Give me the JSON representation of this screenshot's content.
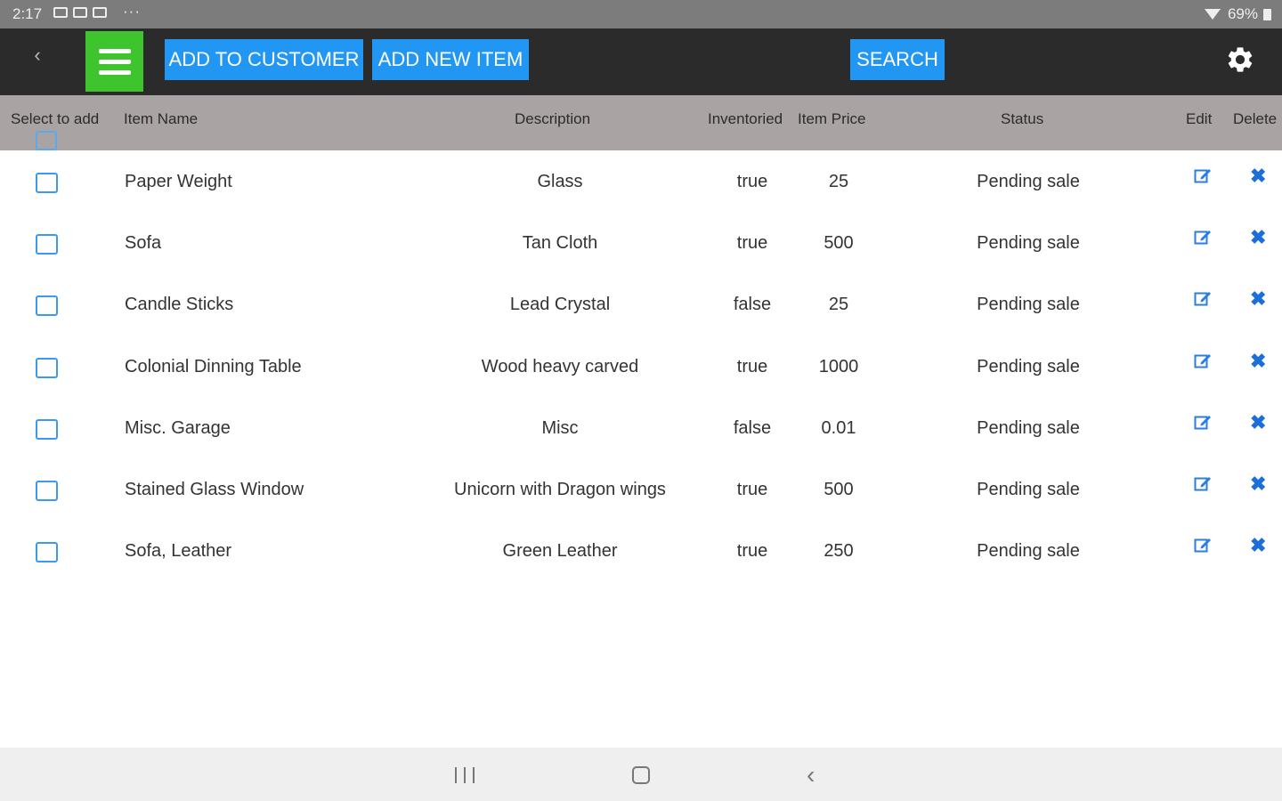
{
  "status_bar": {
    "time": "2:17",
    "more": "···",
    "battery": "69%"
  },
  "toolbar": {
    "back_glyph": "‹",
    "add_to_customer_label": "ADD TO CUSTOMER",
    "add_new_item_label": "ADD NEW ITEM",
    "search_label": "SEARCH",
    "menu_icon": "hamburger-menu-icon",
    "settings_icon": "gear-icon",
    "colors": {
      "background": "#2b2b2b",
      "menu": "#3ec42d",
      "button": "#2196f3"
    }
  },
  "table": {
    "headers": {
      "select": "Select to add",
      "name": "Item Name",
      "description": "Description",
      "inventoried": "Inventoried",
      "price": "Item Price",
      "status": "Status",
      "edit": "Edit",
      "delete": "Delete"
    },
    "header_color": "#a9a3a3",
    "rows": [
      {
        "name": "Paper Weight",
        "description": "Glass",
        "inventoried": "true",
        "price": "25",
        "status": "Pending sale",
        "delete_glyph": "✖"
      },
      {
        "name": "Sofa",
        "description": "Tan Cloth",
        "inventoried": "true",
        "price": "500",
        "status": "Pending sale",
        "delete_glyph": "✖"
      },
      {
        "name": "Candle Sticks",
        "description": "Lead Crystal",
        "inventoried": "false",
        "price": "25",
        "status": "Pending sale",
        "delete_glyph": "✖"
      },
      {
        "name": "Colonial Dinning Table",
        "description": "Wood heavy carved",
        "inventoried": "true",
        "price": "1000",
        "status": "Pending sale",
        "delete_glyph": "✖"
      },
      {
        "name": "Misc. Garage",
        "description": "Misc",
        "inventoried": "false",
        "price": "0.01",
        "status": "Pending sale",
        "delete_glyph": "✖"
      },
      {
        "name": "Stained Glass Window",
        "description": "Unicorn with Dragon wings",
        "inventoried": "true",
        "price": "500",
        "status": "Pending sale",
        "delete_glyph": "✖"
      },
      {
        "name": "Sofa, Leather",
        "description": "Green Leather",
        "inventoried": "true",
        "price": "250",
        "status": "Pending sale",
        "delete_glyph": "✖"
      }
    ]
  },
  "nav_bar": {
    "back_glyph": "‹",
    "icons": [
      "recent-apps-icon",
      "home-icon",
      "back-icon"
    ]
  }
}
